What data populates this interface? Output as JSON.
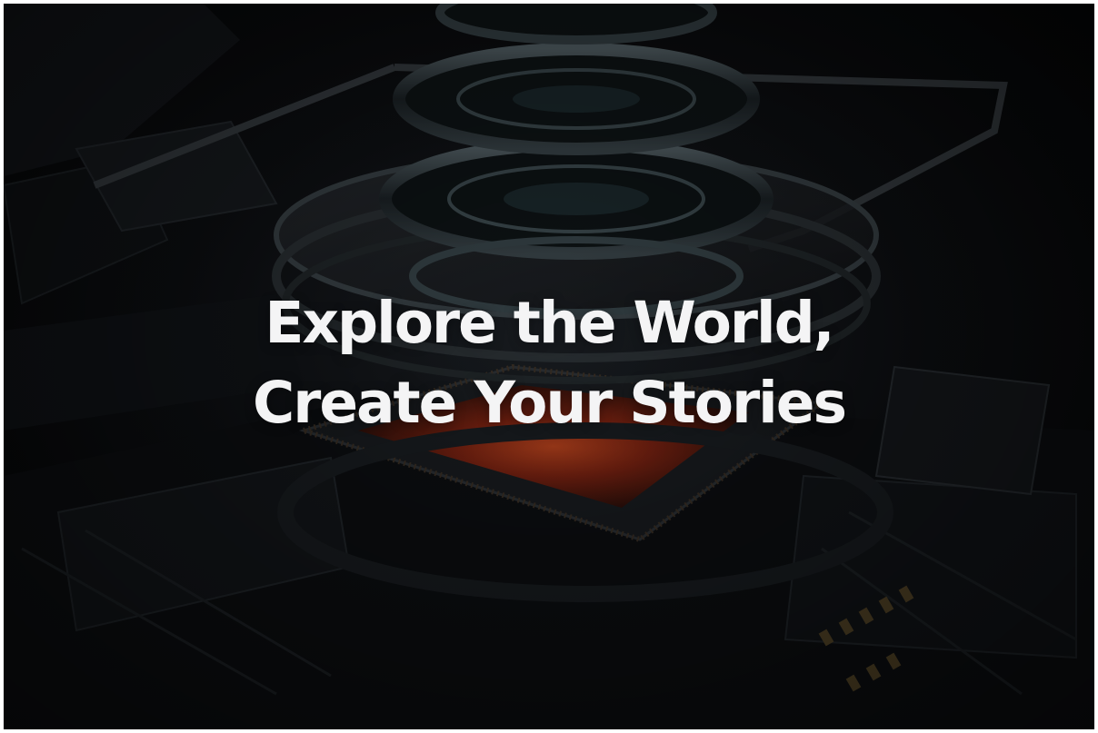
{
  "hero": {
    "headline_line1": "Explore the World,",
    "headline_line2": "Create Your Stories",
    "background_subject": "camera-lens-module-render",
    "colors": {
      "background": "#07080a",
      "headline": "#f4f4f5",
      "sensor_glow": "#c2401c"
    }
  }
}
